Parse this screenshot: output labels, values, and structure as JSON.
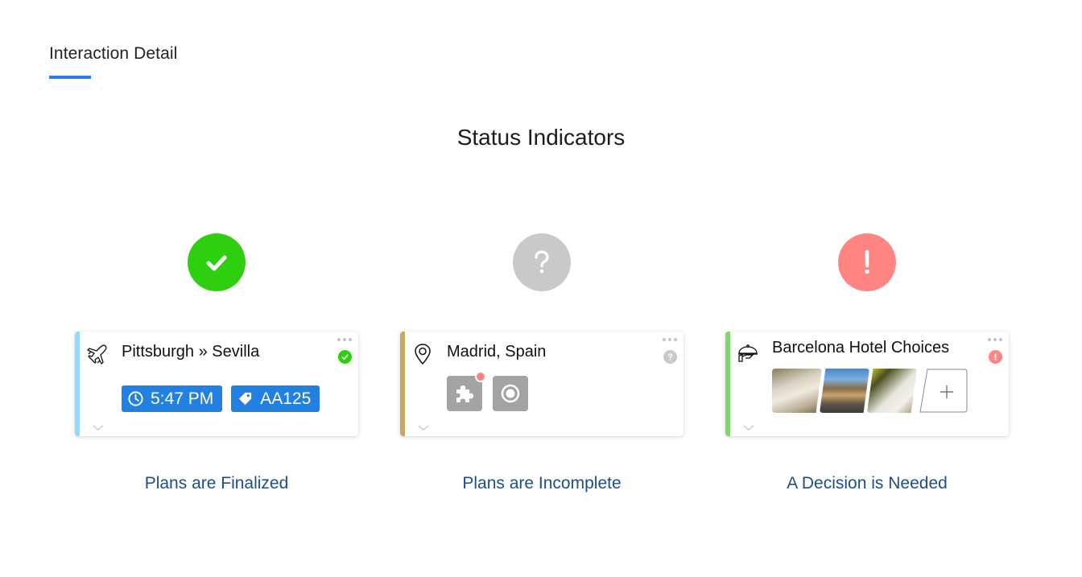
{
  "header": {
    "title": "Interaction Detail"
  },
  "section": {
    "title": "Status Indicators"
  },
  "colors": {
    "accent": "#2281e0",
    "finalized": "#2ecf0f",
    "incomplete": "#c9c9c9",
    "decision": "#ff8582",
    "caption": "#1d4f86"
  },
  "columns": [
    {
      "status": "finalized",
      "status_icon": "check-icon",
      "card": {
        "type_icon": "airplane-icon",
        "stripe_color": "#8fdcff",
        "title": "Pittsburgh » Sevilla",
        "tags": [
          {
            "icon": "clock-icon",
            "label": "5:47 PM"
          },
          {
            "icon": "tag-icon",
            "label": "AA125"
          }
        ]
      },
      "caption": "Plans are Finalized"
    },
    {
      "status": "incomplete",
      "status_icon": "question-icon",
      "card": {
        "type_icon": "map-pin-icon",
        "stripe_color": "#c9a95a",
        "title": "Madrid, Spain",
        "addons": [
          {
            "icon": "puzzle-icon",
            "has_alert_dot": true
          },
          {
            "icon": "radio-target-icon",
            "has_alert_dot": false
          }
        ]
      },
      "caption": "Plans are Incomplete"
    },
    {
      "status": "decision-needed",
      "status_icon": "exclamation-icon",
      "card": {
        "type_icon": "hotel-service-icon",
        "stripe_color": "#7ed86b",
        "title": "Barcelona Hotel Choices",
        "photos": [
          "hotel-bedroom-photo",
          "hotel-rooftop-photo",
          "hotel-room-photo"
        ],
        "add_label": "+"
      },
      "caption": "A Decision is Needed"
    }
  ]
}
